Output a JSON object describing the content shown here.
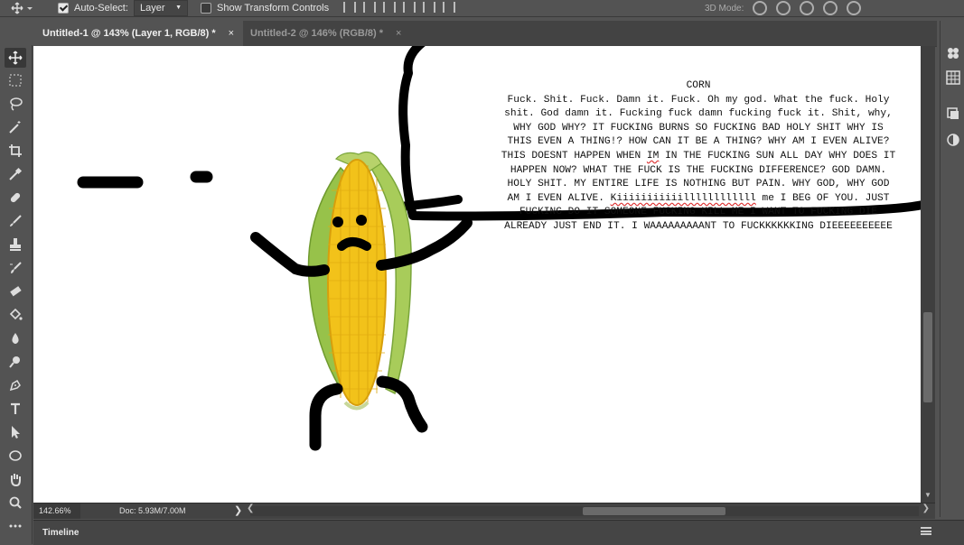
{
  "options_bar": {
    "auto_select_label": "Auto-Select:",
    "auto_select_checked": true,
    "auto_select_target": "Layer",
    "show_transform_label": "Show Transform Controls",
    "show_transform_checked": false,
    "mode_3d_label": "3D Mode:"
  },
  "tabs": [
    {
      "label": "Untitled-1 @ 143% (Layer 1, RGB/8) *",
      "active": true
    },
    {
      "label": "Untitled-2 @ 146% (RGB/8) *",
      "active": false
    }
  ],
  "tab_close_glyph": "×",
  "tools": [
    "move-icon",
    "marquee-icon",
    "lasso-icon",
    "magic-wand-icon",
    "crop-icon",
    "eyedropper-icon",
    "healing-brush-icon",
    "brush-icon",
    "clone-stamp-icon",
    "history-brush-icon",
    "eraser-icon",
    "paint-bucket-icon",
    "blur-icon",
    "dodge-icon",
    "pen-icon",
    "type-icon",
    "path-selection-icon",
    "ellipse-icon",
    "hand-icon",
    "zoom-icon",
    "more-tools-icon"
  ],
  "canvas": {
    "speech_title": "CORN",
    "speech_lines": [
      "Fuck. Shit. Fuck. Damn it. Fuck. Oh my god. What the fuck. Holy",
      "shit. God damn it. Fucking fuck damn fucking fuck it. Shit, why,",
      "WHY GOD WHY? IT FUCKING BURNS SO FUCKING BAD HOLY SHIT WHY IS",
      "THIS EVEN A THING!? HOW CAN IT BE A THING? WHY AM I EVEN ALIVE?",
      "THIS DOESNT HAPPEN WHEN |IM| IN THE FUCKING SUN ALL DAY WHY DOES IT",
      "HAPPEN NOW? WHAT THE FUCK IS THE FUCKING DIFFERENCE? GOD DAMN.",
      "HOLY SHIT. MY ENTIRE LIFE IS NOTHING BUT PAIN. WHY GOD, WHY GOD",
      "AM I EVEN ALIVE. |Kiiiiiiiiiiillllllllllll| me I BEG OF YOU. JUST",
      "FUCKING DO IT SOMEONE FUCKING KILL ME I WANT TO FUCKING DIE",
      "ALREADY JUST END IT. I WAAAAAAAAANT TO FUCKKKKKKING DIEEEEEEEEEE"
    ]
  },
  "right_panel_icons": [
    "plugins-icon",
    "grid-icon",
    "layers-icon",
    "adjust-icon"
  ],
  "status": {
    "zoom": "142.66%",
    "doc": "Doc: 5.93M/7.00M",
    "chevron": "❯"
  },
  "timeline": {
    "label": "Timeline"
  },
  "colors": {
    "ui_dark": "#535353",
    "canvas": "#ffffff",
    "corn_yellow": "#f2c21a",
    "husk_green": "#8fbf3a"
  }
}
